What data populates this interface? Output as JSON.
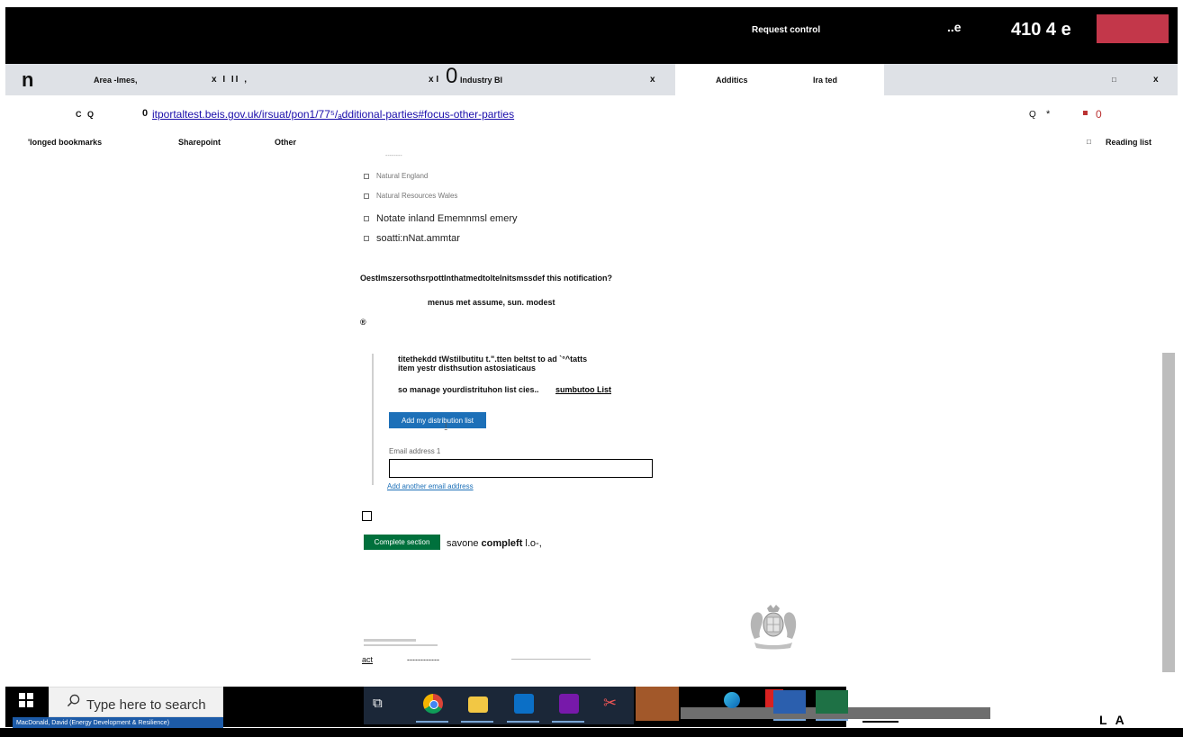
{
  "titlebar": {
    "request_control": "Request control",
    "glyph_e": "..e",
    "counter": "410 4 e"
  },
  "tabs": {
    "logo": "n",
    "tab1_label": "Area -Imes,",
    "tab1_close": "x I II ,",
    "tab2_prefix": "x I",
    "tab2_zero": "0",
    "tab2_label": "Industry BI",
    "tab2_close": "x",
    "tab3_label": "Additics",
    "tab3_label2": "Ira ted",
    "restore": "□",
    "close": "x"
  },
  "address": {
    "nav": "C Q",
    "prefix": "0",
    "url": "itportaltest.beis.gov.uk/irsuat/pon1/77⁵/ₐdditional-parties#focus-other-parties",
    "search": "Q",
    "star": "*",
    "count": "0"
  },
  "bookmarks": {
    "items": [
      "'longed bookmarks",
      "Sharepoint",
      "Other"
    ],
    "reading_icon": "□",
    "reading_list": "Reading list"
  },
  "parties": {
    "dash": "--------",
    "options": [
      "Natural England",
      "Natural Resources Wales",
      "Notate inland Ememnmsl emery",
      "soatti:nNat.ammtar"
    ]
  },
  "question": {
    "text": "OestImszersothsrpottInthatmedtolteInitsmssdef this notification?",
    "subtext": "menus met assume, sun. modest",
    "radio": "®"
  },
  "distribution": {
    "line1": "titethekdd tWstilbutitu t.\".tten beltst to ad `°^tatts",
    "line2": "item yestr disthsution    astosiaticaus",
    "line3": "so manage yourdistrituhon list cies..",
    "link": "sumbutoo List",
    "add_button": "Add my distribution list",
    "cursor": "Ḭ",
    "email_label": "Email address 1",
    "email_value": "",
    "add_email_link": "Add another email address"
  },
  "completion": {
    "button": "Complete section",
    "save_prefix": "savone ",
    "save_bold": "compleft",
    "save_suffix": " l.o-,"
  },
  "footer": {
    "act": "act",
    "dashes": "------------"
  },
  "taskbar": {
    "search_placeholder": "Type here to search",
    "user": "MacDonald, David (Energy Development & Resilience)",
    "taskview": "⧉",
    "snip": "✂",
    "tray": "L A"
  },
  "colors": {
    "primary_button": "#1d70b8",
    "complete_button": "#00703c",
    "tab_red": "#c3374a",
    "link": "#1a0dab"
  }
}
